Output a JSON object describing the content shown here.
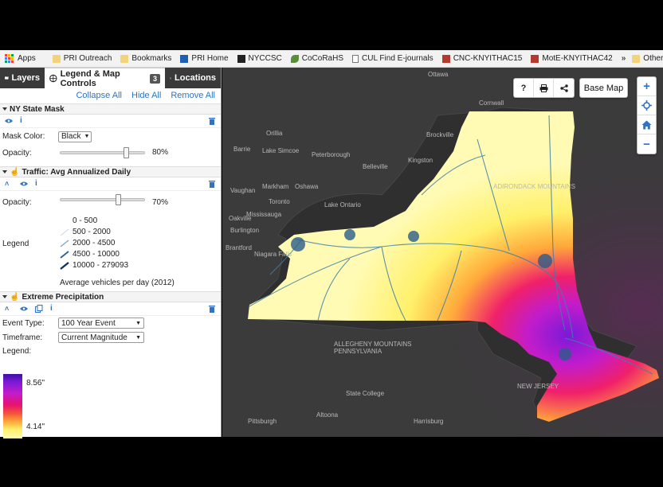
{
  "bookmarks": [
    {
      "label": "Apps",
      "icon": "apps-grid-icon"
    },
    {
      "label": "PRI Outreach",
      "icon": "folder-icon"
    },
    {
      "label": "Bookmarks",
      "icon": "folder-icon"
    },
    {
      "label": "PRI Home",
      "icon": "pri-logo-icon"
    },
    {
      "label": "NYCCSC",
      "icon": "nyccsc-logo-icon"
    },
    {
      "label": "CoCoRaHS",
      "icon": "cocorahs-logo-icon"
    },
    {
      "label": "CUL Find E-journals",
      "icon": "page-icon"
    },
    {
      "label": "CNC-KNYITHAC15",
      "icon": "wunderground-icon"
    },
    {
      "label": "MotE-KNYITHAC42",
      "icon": "wunderground-icon"
    }
  ],
  "bookmarks_more": "»",
  "bookmarks_other": "Other bookmarks",
  "tabs": {
    "layers": "Layers",
    "legend": "Legend & Map Controls",
    "legend_count": "3",
    "locations": "Locations"
  },
  "actions": {
    "collapse": "Collapse All",
    "hide": "Hide All",
    "remove": "Remove All"
  },
  "mask": {
    "title": "NY State Mask",
    "color_label": "Mask Color:",
    "color_value": "Black",
    "opacity_label": "Opacity:",
    "opacity_value": "80%",
    "opacity": 0.8
  },
  "traffic": {
    "title": "Traffic: Avg Annualized Daily",
    "opacity_label": "Opacity:",
    "opacity_value": "70%",
    "opacity": 0.7,
    "legend_label": "Legend",
    "legend_items": [
      "0 - 500",
      "500 - 2000",
      "2000 - 4500",
      "4500 - 10000",
      "10000 - 279093"
    ],
    "legend_note": "Average vehicles per day (2012)"
  },
  "precip": {
    "title": "Extreme Precipitation",
    "event_label": "Event Type:",
    "event_value": "100 Year Event",
    "timeframe_label": "Timeframe:",
    "timeframe_value": "Current Magnitude",
    "legend_label": "Legend:",
    "legend_max": "8.56\"",
    "legend_min": "4.14\""
  },
  "map": {
    "base_map_label": "Base Map",
    "buttons": [
      "?",
      "print-icon",
      "share-icon"
    ],
    "zoom": [
      "+",
      "locate-icon",
      "home-icon",
      "−"
    ],
    "places": [
      "Ottawa",
      "Cornwall",
      "Brockville",
      "Orillia",
      "Barrie",
      "Lake Simcoe",
      "Peterborough",
      "Belleville",
      "Kingston",
      "Markham",
      "Oshawa",
      "Vaughan",
      "Toronto",
      "Mississauga",
      "Oakville",
      "Burlington",
      "Brantford",
      "Lake Ontario",
      "Niagara Falls",
      "ADIRONDACK MOUNTAINS",
      "ALLEGHENY MOUNTAINS",
      "PENNSYLVANIA",
      "State College",
      "Altoona",
      "Pittsburgh",
      "NEW JERSEY",
      "Harrisburg"
    ],
    "colors": {
      "low": "#fffbb4",
      "mid": "#f55838",
      "high": "#7a1ad8",
      "roads": "#3f7fa8"
    }
  }
}
